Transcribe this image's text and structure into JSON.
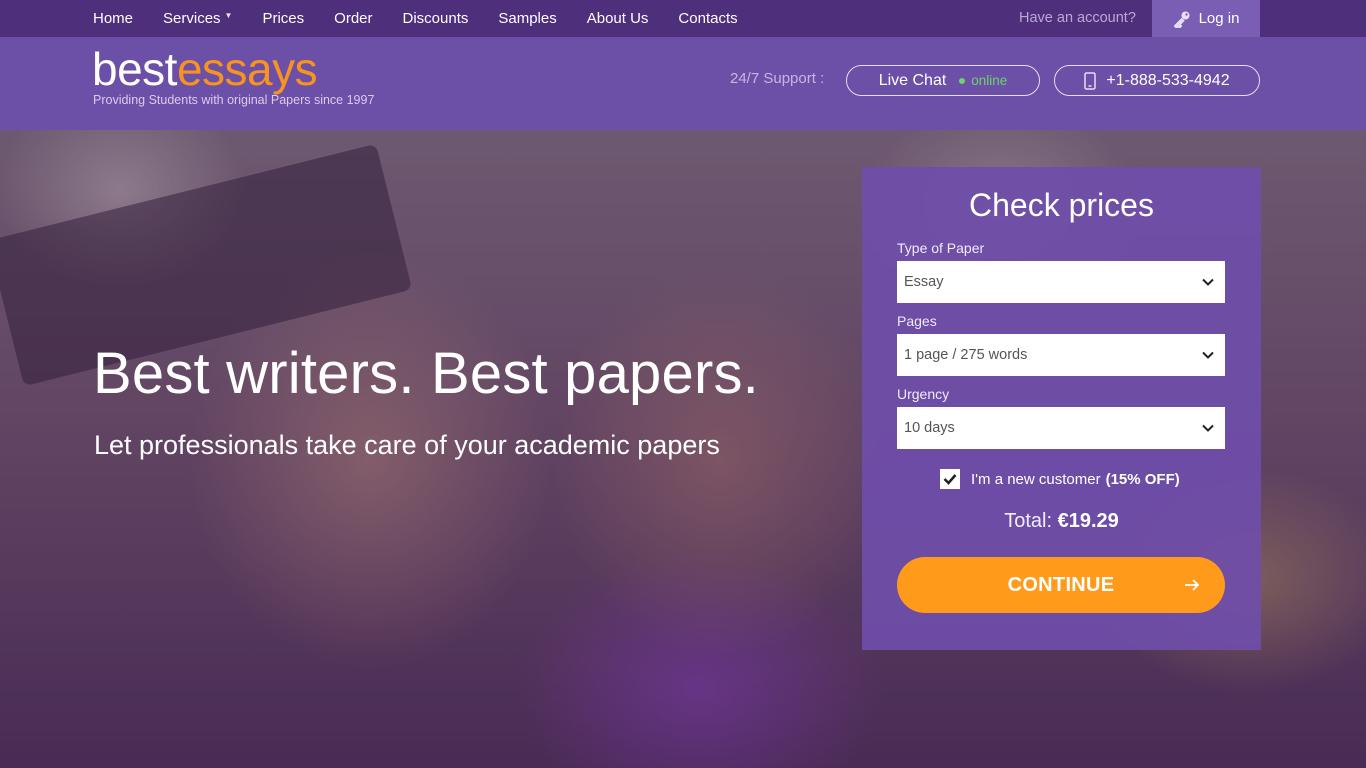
{
  "nav": {
    "links": [
      "Home",
      "Services",
      "Prices",
      "Order",
      "Discounts",
      "Samples",
      "About Us",
      "Contacts"
    ],
    "account_prompt": "Have an account?",
    "login_label": "Log in"
  },
  "header": {
    "logo_part1": "best",
    "logo_part2": "essays",
    "tagline": "Providing Students with original Papers since 1997",
    "support_label": "24/7 Support :",
    "live_chat_label": "Live Chat",
    "live_chat_status": "online",
    "phone": "+1-888-533-4942"
  },
  "hero": {
    "headline": "Best writers.  Best papers.",
    "subheadline": "Let professionals take care of your academic papers"
  },
  "price_form": {
    "title": "Check prices",
    "paper_type_label": "Type of Paper",
    "paper_type_value": "Essay",
    "pages_label": "Pages",
    "pages_value": "1 page / 275 words",
    "urgency_label": "Urgency",
    "urgency_value": "10 days",
    "new_customer_label": "I'm a new customer",
    "new_customer_discount": "(15% OFF)",
    "new_customer_checked": true,
    "total_label": "Total:",
    "total_value": "€19.29",
    "continue_label": "CONTINUE"
  },
  "colors": {
    "topnav_bg": "#4d2f7c",
    "header_bg": "#6c4fa6",
    "accent_orange": "#f7931e",
    "button_orange": "#ff9a1a",
    "online_green": "#6bd46b"
  },
  "icons": [
    "key-icon",
    "phone-icon",
    "chevron-down-icon",
    "check-icon",
    "arrow-right-icon",
    "caret-down-icon"
  ]
}
